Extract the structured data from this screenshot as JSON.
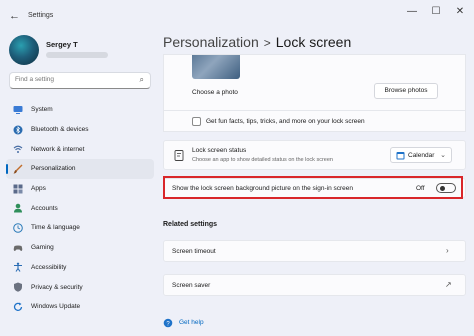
{
  "window": {
    "title": "Settings",
    "back_icon": "←",
    "minimize": "—",
    "maximize": "☐",
    "close": "✕"
  },
  "user": {
    "name": "Sergey T"
  },
  "search": {
    "placeholder": "Find a setting"
  },
  "sidebar": {
    "items": [
      {
        "label": "System",
        "icon": "monitor-icon",
        "color": "#3a7bd5",
        "active": false
      },
      {
        "label": "Bluetooth & devices",
        "icon": "bluetooth-icon",
        "color": "#2b6cb0",
        "active": false
      },
      {
        "label": "Network & internet",
        "icon": "wifi-icon",
        "color": "#4a6fa5",
        "active": false
      },
      {
        "label": "Personalization",
        "icon": "brush-icon",
        "color": "#c26d2a",
        "active": true
      },
      {
        "label": "Apps",
        "icon": "apps-icon",
        "color": "#5a6a8a",
        "active": false
      },
      {
        "label": "Accounts",
        "icon": "person-icon",
        "color": "#2f8f5b",
        "active": false
      },
      {
        "label": "Time & language",
        "icon": "globe-clock-icon",
        "color": "#2a7ab8",
        "active": false
      },
      {
        "label": "Gaming",
        "icon": "gamepad-icon",
        "color": "#6b6b6b",
        "active": false
      },
      {
        "label": "Accessibility",
        "icon": "accessibility-icon",
        "color": "#2a6db5",
        "active": false
      },
      {
        "label": "Privacy & security",
        "icon": "shield-icon",
        "color": "#6b7280",
        "active": false
      },
      {
        "label": "Windows Update",
        "icon": "update-icon",
        "color": "#1f73c9",
        "active": false
      }
    ]
  },
  "breadcrumb": {
    "parent": "Personalization",
    "separator": ">",
    "current": "Lock screen"
  },
  "main": {
    "choose_photo_label": "Choose a photo",
    "browse_button": "Browse photos",
    "fun_facts_label": "Get fun facts, tips, tricks, and more on your lock screen",
    "status_title": "Lock screen status",
    "status_desc": "Choose an app to show detailed status on the lock screen",
    "status_value": "Calendar",
    "signin_label": "Show the lock screen background picture on the sign-in screen",
    "signin_state": "Off",
    "related_title": "Related settings",
    "timeout_label": "Screen timeout",
    "saver_label": "Screen saver",
    "help_label": "Get help"
  },
  "colors": {
    "accent": "#0067c0",
    "highlight": "#d9262a"
  }
}
